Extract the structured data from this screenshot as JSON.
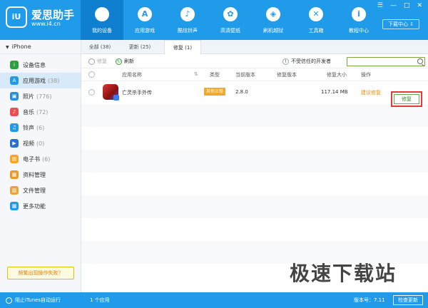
{
  "app": {
    "title": "爱思助手",
    "url": "www.i4.cn",
    "logo_mark": "iU"
  },
  "window_controls": [
    "☰",
    "—",
    "□",
    "✕"
  ],
  "nav": [
    {
      "label": "我的设备",
      "icon": "apple-icon",
      "glyph": "",
      "active": true
    },
    {
      "label": "应用游戏",
      "icon": "app-store-icon",
      "glyph": "A"
    },
    {
      "label": "酷炫铃声",
      "icon": "bell-icon",
      "glyph": "♪"
    },
    {
      "label": "高清壁纸",
      "icon": "flower-icon",
      "glyph": "✿"
    },
    {
      "label": "刷机越狱",
      "icon": "box-icon",
      "glyph": "◈"
    },
    {
      "label": "工具箱",
      "icon": "tools-icon",
      "glyph": "✕"
    },
    {
      "label": "教程中心",
      "icon": "info-icon",
      "glyph": "i"
    }
  ],
  "download_center": "下载中心 ⇩",
  "sidebar": {
    "device": "iPhone",
    "items": [
      {
        "label": "设备信息",
        "count": "",
        "color": "#2e9e3e",
        "glyph": "i"
      },
      {
        "label": "应用游戏",
        "count": "(38)",
        "color": "#1f9bea",
        "glyph": "A",
        "active": true
      },
      {
        "label": "照片",
        "count": "(776)",
        "color": "#2b8be0",
        "glyph": "▣"
      },
      {
        "label": "音乐",
        "count": "(72)",
        "color": "#e8504f",
        "glyph": "♪"
      },
      {
        "label": "铃声",
        "count": "(6)",
        "color": "#1f9bea",
        "glyph": "♫"
      },
      {
        "label": "视频",
        "count": "(0)",
        "color": "#2b6fd6",
        "glyph": "▶"
      },
      {
        "label": "电子书",
        "count": "(6)",
        "color": "#f5a623",
        "glyph": "▤"
      },
      {
        "label": "资料管理",
        "count": "",
        "color": "#e89b2b",
        "glyph": "▦"
      },
      {
        "label": "文件管理",
        "count": "",
        "color": "#e8a33b",
        "glyph": "▥"
      },
      {
        "label": "更多功能",
        "count": "",
        "color": "#1f9bea",
        "glyph": "▦"
      }
    ],
    "fail_button": "频繁出现操作失败？"
  },
  "tabs": [
    {
      "label": "全部 (38)"
    },
    {
      "label": "更新 (25)"
    },
    {
      "label": "修复 (1)",
      "active": true
    }
  ],
  "toolbar": {
    "repair": "修复",
    "refresh": "刷新",
    "untrusted": "不受信任的开发者",
    "search_placeholder": ""
  },
  "table": {
    "headers": [
      "应用名称",
      "类型",
      "当前版本",
      "修复版本",
      "修复大小",
      "操作"
    ],
    "sort_glyph": "⇅",
    "rows": [
      {
        "name": "亡灵杀手外传",
        "type": "其他正版",
        "current_version": "2.8.0",
        "repair_version": "",
        "size": "117.14 MB",
        "suggestion": "建议修复",
        "action": "修复"
      }
    ]
  },
  "footer": {
    "itunes": "阻止iTunes自动运行",
    "count": "1 个应用",
    "version": "版本号：7.11",
    "check_update": "检查更新"
  },
  "watermark": "极速下载站"
}
